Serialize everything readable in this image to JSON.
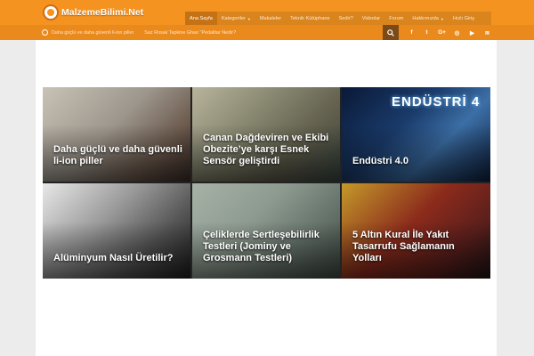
{
  "site": {
    "logo_text": "MalzemeBilimi.Net"
  },
  "nav": {
    "items": [
      {
        "label": "Ana Sayfa",
        "has_caret": false,
        "active": true
      },
      {
        "label": "Kategoriler",
        "has_caret": true,
        "active": false
      },
      {
        "label": "Makaleler",
        "has_caret": false,
        "active": false
      },
      {
        "label": "Teknik Kütüphane",
        "has_caret": false,
        "active": false
      },
      {
        "label": "Sedir?",
        "has_caret": false,
        "active": false
      },
      {
        "label": "Videolar",
        "has_caret": false,
        "active": false
      },
      {
        "label": "Forum",
        "has_caret": false,
        "active": false
      },
      {
        "label": "Hakkımızda",
        "has_caret": true,
        "active": false
      },
      {
        "label": "Hızlı Giriş",
        "has_caret": false,
        "active": false
      }
    ]
  },
  "ticker": {
    "items": [
      "Daha güçlü ve daha güvenli li-ion piller",
      "Saz Rosak Tapkine Ghao \"Pedalitar Nedir?"
    ]
  },
  "social": [
    "f",
    "t",
    "G+",
    "◎",
    "▶",
    "≋"
  ],
  "social_names": [
    "facebook-icon",
    "twitter-icon",
    "google-plus-icon",
    "instagram-icon",
    "youtube-icon",
    "rss-icon"
  ],
  "colors": {
    "topbar": "#f59321",
    "nav": "#d9841d",
    "subbar": "#ea8a1c",
    "search": "#7b4a17"
  },
  "tiles": [
    {
      "caption": "Daha güçlü ve daha güvenli li-ion piller",
      "gradient": "linear-gradient(135deg,#c9c2b6 0%,#9d968c 45%,#6c5a4d 75%,#3a2b26 100%)"
    },
    {
      "caption": "Canan Dağdeviren ve Ekibi Obezite’ye karşı Esnek Sensör geliştirdi",
      "gradient": "linear-gradient(135deg,#b9b39c 0%,#8a8a73 35%,#5f5d4b 70%,#37453f 100%)"
    },
    {
      "caption": "Endüstri 4.0",
      "gradient": "linear-gradient(135deg,#0a1936 0%,#1a3b6b 40%,#3c6fa6 65%,#0d1f3e 100%)"
    },
    {
      "caption": "Alüminyum Nasıl Üretilir?",
      "gradient": "linear-gradient(135deg,#e8e8e8 0%,#9a9a9a 40%,#565656 70%,#1d1d1d 100%)"
    },
    {
      "caption": "Çeliklerde Sertleşebilirlik Testleri (Jominy ve Grosmann Testleri)",
      "gradient": "linear-gradient(135deg,#a7b2a7 0%,#8d9a8f 40%,#65726a 70%,#3c463f 100%)"
    },
    {
      "caption": "5 Altın Kural İle Yakıt Tasarrufu Sağlamanın Yolları",
      "gradient": "linear-gradient(135deg,#c49a2a 0%,#8c2b1c 45%,#5a1f1c 75%,#1e1414 100%)"
    }
  ],
  "tile_heading_3": "ENDÜSTRİ 4"
}
